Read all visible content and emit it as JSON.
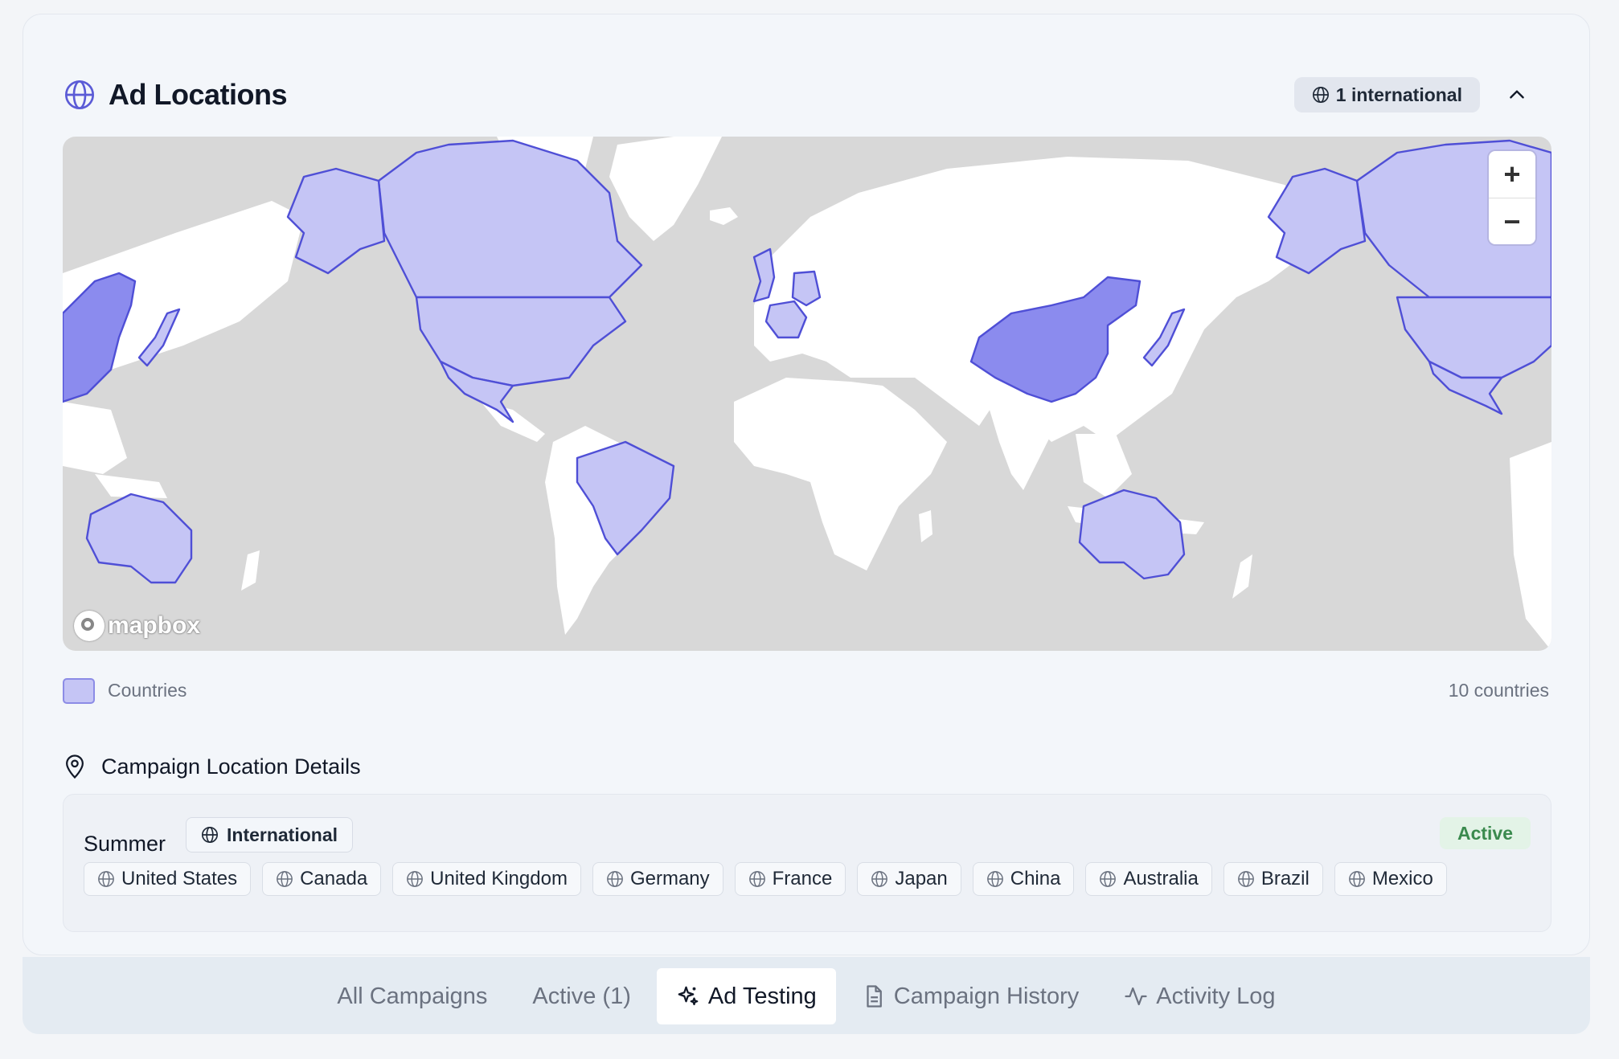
{
  "header": {
    "title": "Ad Locations",
    "title_icon": "globe-icon",
    "intl_badge": "1 international",
    "collapse_icon": "chevron-up-icon"
  },
  "map": {
    "zoom_in": "+",
    "zoom_out": "−",
    "attribution": "mapbox",
    "colors": {
      "ocean": "#d8d8d8",
      "land": "#ffffff",
      "selected": "#c5c5f5",
      "selected_strong": "#8b8bee",
      "border": "#4f4fd6"
    },
    "highlighted_countries": [
      "United States",
      "Canada",
      "United Kingdom",
      "Germany",
      "France",
      "Japan",
      "China",
      "Australia",
      "Brazil",
      "Mexico"
    ]
  },
  "legend": {
    "label": "Countries",
    "count": "10 countries"
  },
  "details": {
    "title": "Campaign Location Details",
    "campaign": {
      "name": "Summer",
      "scope": "International",
      "status": "Active",
      "countries": [
        "United States",
        "Canada",
        "United Kingdom",
        "Germany",
        "France",
        "Japan",
        "China",
        "Australia",
        "Brazil",
        "Mexico"
      ]
    }
  },
  "tabs": [
    {
      "label": "All Campaigns",
      "icon": "",
      "active": false
    },
    {
      "label": "Active (1)",
      "icon": "",
      "active": false
    },
    {
      "label": "Ad Testing",
      "icon": "sparkles-icon",
      "active": true
    },
    {
      "label": "Campaign History",
      "icon": "document-icon",
      "active": false
    },
    {
      "label": "Activity Log",
      "icon": "activity-icon",
      "active": false
    }
  ]
}
